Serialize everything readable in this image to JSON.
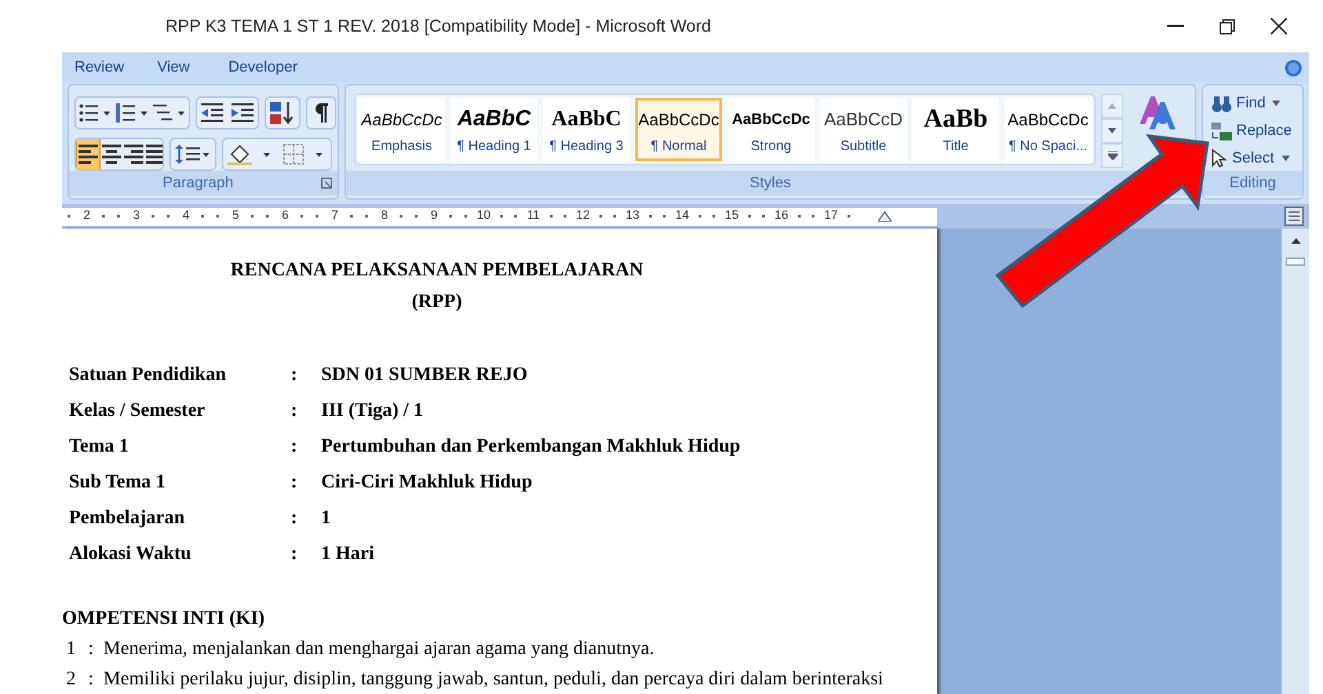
{
  "window": {
    "title": "RPP K3 TEMA 1 ST 1 REV. 2018 [Compatibility Mode] - Microsoft Word"
  },
  "ribbon_tabs": [
    {
      "label": "Review",
      "selected": false
    },
    {
      "label": "View",
      "selected": false
    },
    {
      "label": "Developer",
      "selected": false
    }
  ],
  "paragraph_group": {
    "label": "Paragraph",
    "alignment": [
      {
        "selected": true
      },
      {
        "selected": false
      },
      {
        "selected": false
      },
      {
        "selected": false
      }
    ]
  },
  "styles_group": {
    "label": "Styles",
    "items": [
      {
        "preview": "AaBbCcDc",
        "name": "Emphasis",
        "kind": "emphasis",
        "selected": false
      },
      {
        "preview": "AaBbC",
        "name": "¶ Heading 1",
        "kind": "heading1",
        "selected": false
      },
      {
        "preview": "AaBbC",
        "name": "¶ Heading 3",
        "kind": "heading3",
        "selected": false
      },
      {
        "preview": "AaBbCcDc",
        "name": "¶ Normal",
        "kind": "normal",
        "selected": true
      },
      {
        "preview": "AaBbCcDc",
        "name": "Strong",
        "kind": "strong",
        "selected": false
      },
      {
        "preview": "AaBbCcD",
        "name": "Subtitle",
        "kind": "subtitle",
        "selected": false
      },
      {
        "preview": "AaBb",
        "name": "Title",
        "kind": "title",
        "selected": false
      },
      {
        "preview": "AaBbCcDc",
        "name": "¶ No Spaci...",
        "kind": "normal",
        "selected": false
      }
    ]
  },
  "editing_group": {
    "label": "Editing",
    "items": [
      {
        "label": "Find",
        "kind": "find"
      },
      {
        "label": "Replace",
        "kind": "replace"
      },
      {
        "label": "Select",
        "kind": "select"
      }
    ]
  },
  "ruler": {
    "numbers": [
      "2",
      "3",
      "4",
      "5",
      "6",
      "7",
      "8",
      "9",
      "10",
      "11",
      "12",
      "13",
      "14",
      "15",
      "16",
      "17"
    ]
  },
  "document": {
    "title": "RENCANA PELAKSANAAN PEMBELAJARAN",
    "subtitle": "(RPP)",
    "fields": [
      {
        "label": "Satuan Pendidikan",
        "colon": ":",
        "value": "SDN 01 SUMBER REJO"
      },
      {
        "label": "Kelas / Semester",
        "colon": ":",
        "value": "III (Tiga) / 1"
      },
      {
        "label": "Tema 1",
        "colon": ":",
        "value": "Pertumbuhan dan Perkembangan Makhluk Hidup"
      },
      {
        "label": "Sub Tema 1",
        "colon": ":",
        "value": "Ciri-Ciri Makhluk Hidup"
      },
      {
        "label": "Pembelajaran",
        "colon": ":",
        "value": "1"
      },
      {
        "label": "Alokasi Waktu",
        "colon": ":",
        "value": "1 Hari"
      }
    ],
    "section_heading": "OMPETENSI INTI (KI)",
    "items": [
      {
        "number": "1",
        "colon": ":",
        "text": "Menerima, menjalankan dan menghargai ajaran agama yang dianutnya."
      },
      {
        "number": "2",
        "colon": ":",
        "text": "Memiliki perilaku jujur, disiplin, tanggung jawab, santun, peduli, dan percaya diri dalam berinteraksi"
      }
    ]
  }
}
